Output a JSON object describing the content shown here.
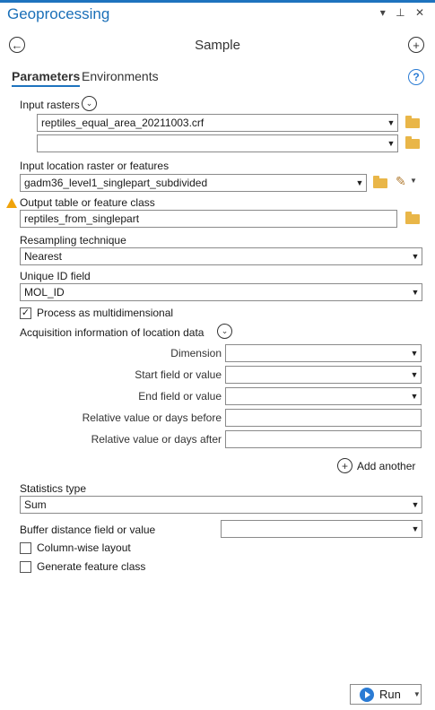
{
  "pane": {
    "title": "Geoprocessing",
    "controls": "▾ ⊥ ✕"
  },
  "tool": {
    "name": "Sample"
  },
  "tabs": [
    {
      "label": "Parameters"
    },
    {
      "label": "Environments"
    }
  ],
  "help": {
    "glyph": "?"
  },
  "params": {
    "input_rasters": {
      "label": "Input rasters",
      "rows": [
        "reptiles_equal_area_20211003.crf",
        ""
      ]
    },
    "input_location": {
      "label": "Input location raster or features",
      "value": "gadm36_level1_singlepart_subdivided"
    },
    "output_table": {
      "label": "Output table or feature class",
      "value": "reptiles_from_singlepart"
    },
    "resampling": {
      "label": "Resampling technique",
      "value": "Nearest"
    },
    "unique_id": {
      "label": "Unique ID field",
      "value": "MOL_ID"
    },
    "process_multidim": {
      "label": "Process as multidimensional",
      "checked": true
    },
    "acquisition": {
      "label": "Acquisition information of location data",
      "dimension": {
        "label": "Dimension",
        "value": ""
      },
      "start": {
        "label": "Start field or value",
        "value": ""
      },
      "end": {
        "label": "End field or value",
        "value": ""
      },
      "rel_before": {
        "label": "Relative value or days before",
        "value": ""
      },
      "rel_after": {
        "label": "Relative value or days after",
        "value": ""
      },
      "add_another": "Add another"
    },
    "statistics": {
      "label": "Statistics type",
      "value": "Sum"
    },
    "buffer": {
      "label": "Buffer distance field or value",
      "value": ""
    },
    "column_wise": {
      "label": "Column-wise layout",
      "checked": false
    },
    "generate_fc": {
      "label": "Generate feature class",
      "checked": false
    }
  },
  "run": {
    "label": "Run"
  },
  "colors": {
    "accent": "#1e73be",
    "folder": "#e9b648",
    "warning": "#f0a30a"
  }
}
